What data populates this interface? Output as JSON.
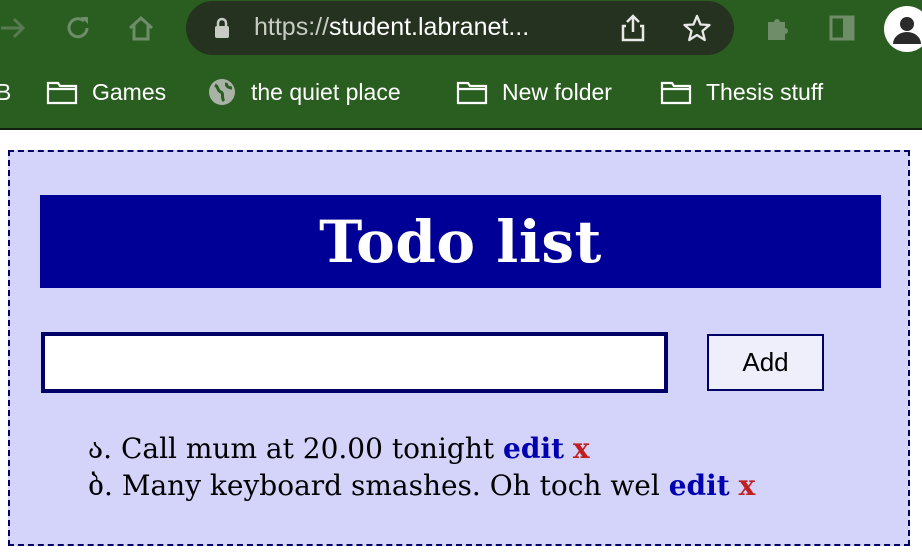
{
  "browser": {
    "url_scheme": "https://",
    "url_host": "student.labranet...",
    "bookmarks": [
      {
        "label": "B"
      },
      {
        "label": "Games",
        "icon": "folder-icon"
      },
      {
        "label": "the quiet place",
        "icon": "globe-icon"
      },
      {
        "label": "New folder",
        "icon": "folder-icon"
      },
      {
        "label": "Thesis stuff",
        "icon": "folder-icon"
      }
    ],
    "colors": {
      "chrome": "#2a5d20",
      "urlbar": "#25321f"
    }
  },
  "app": {
    "title": "Todo list",
    "input": {
      "value": "",
      "placeholder": ""
    },
    "add_label": "Add",
    "todos": [
      {
        "marker": "ა.",
        "text": "Call mum at 20.00 tonight",
        "edit_label": "edit",
        "delete_label": "x"
      },
      {
        "marker": "ბ.",
        "text": "Many keyboard smashes. Oh toch wel",
        "edit_label": "edit",
        "delete_label": "x"
      }
    ],
    "colors": {
      "background": "#d4d4fb",
      "title_bar": "#000096",
      "edit": "#0000b0",
      "delete": "#c02020"
    }
  }
}
